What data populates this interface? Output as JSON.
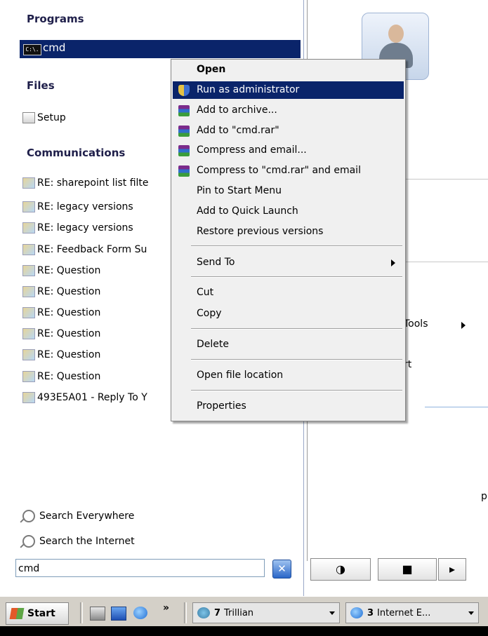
{
  "left": {
    "headers": {
      "programs": "Programs",
      "files": "Files",
      "communications": "Communications"
    },
    "program": {
      "icon_text": "C:\\.",
      "label": "cmd"
    },
    "files": [
      {
        "label": "Setup"
      }
    ],
    "communications": [
      {
        "label": "RE: sharepoint list filte"
      },
      {
        "label": "RE: legacy versions"
      },
      {
        "label": "RE: legacy versions"
      },
      {
        "label": "RE: Feedback Form Su"
      },
      {
        "label": "RE: Question"
      },
      {
        "label": "RE: Question"
      },
      {
        "label": "RE: Question"
      },
      {
        "label": "RE: Question"
      },
      {
        "label": "RE: Question"
      },
      {
        "label": "RE: Question"
      },
      {
        "label": "493E5A01 - Reply To Y"
      }
    ],
    "search_links": [
      "Search Everywhere",
      "Search the Internet"
    ],
    "search_box": {
      "value": "cmd",
      "clear": "✕"
    }
  },
  "context_menu": {
    "items": [
      {
        "label": "Open"
      },
      {
        "label": "Run as administrator"
      },
      {
        "label": "Add to archive..."
      },
      {
        "label": "Add to \"cmd.rar\""
      },
      {
        "label": "Compress and email..."
      },
      {
        "label": "Compress to \"cmd.rar\" and email"
      },
      {
        "label": "Pin to Start Menu"
      },
      {
        "label": "Add to Quick Launch"
      },
      {
        "label": "Restore previous versions"
      },
      {
        "label": "Send To"
      },
      {
        "label": "Cut"
      },
      {
        "label": "Copy"
      },
      {
        "label": "Delete"
      },
      {
        "label": "Open file location"
      },
      {
        "label": "Properties"
      }
    ]
  },
  "right": {
    "tools_fragment": "Tools",
    "support_fragment": "rt",
    "edge_fragment": "p"
  },
  "taskbar": {
    "start": "Start",
    "chevron": "»",
    "tasks": [
      {
        "count": "7",
        "label": "Trillian"
      },
      {
        "count": "3",
        "label": "Internet E..."
      }
    ]
  }
}
